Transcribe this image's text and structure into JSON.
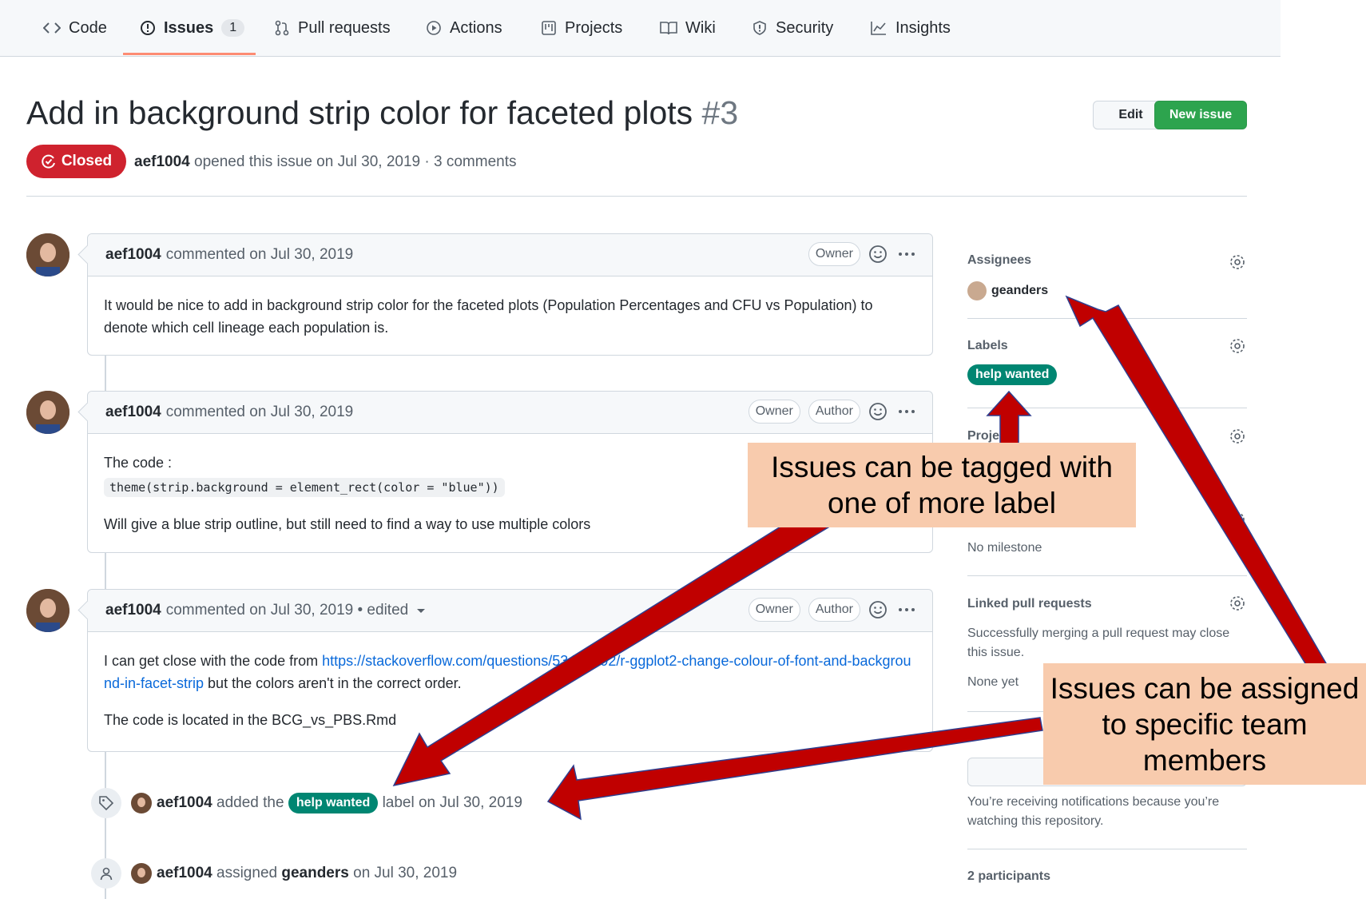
{
  "nav": {
    "tabs": [
      {
        "label": "Code"
      },
      {
        "label": "Issues",
        "count": "1"
      },
      {
        "label": "Pull requests"
      },
      {
        "label": "Actions"
      },
      {
        "label": "Projects"
      },
      {
        "label": "Wiki"
      },
      {
        "label": "Security"
      },
      {
        "label": "Insights"
      }
    ]
  },
  "issue": {
    "title": "Add in background strip color for faceted plots",
    "number": "#3",
    "state": "Closed",
    "author": "aef1004",
    "meta_text": "opened this issue on Jul 30, 2019 · 3 comments",
    "edit_label": "Edit",
    "new_issue_label": "New issue"
  },
  "comments": [
    {
      "author": "aef1004",
      "header_text": "commented on Jul 30, 2019",
      "roles": [
        "Owner"
      ],
      "body": "It would be nice to add in background strip color for the faceted plots (Population Percentages and CFU vs Population) to denote which cell lineage each population is."
    },
    {
      "author": "aef1004",
      "header_text": "commented on Jul 30, 2019",
      "roles": [
        "Owner",
        "Author"
      ],
      "line1": "The code :",
      "code": "theme(strip.background = element_rect(color = \"blue\"))",
      "line2": "Will give a blue strip outline, but still need to find a way to use multiple colors"
    },
    {
      "author": "aef1004",
      "header_text": "commented on Jul 30, 2019 • edited",
      "roles": [
        "Owner",
        "Author"
      ],
      "prefix": "I can get close with the code from ",
      "link": "https://stackoverflow.com/questions/53455092/r-ggplot2-change-colour-of-font-and-background-in-facet-strip",
      "suffix": " but the colors aren't in the correct order.",
      "line2": "The code is located in the BCG_vs_PBS.Rmd"
    }
  ],
  "events": [
    {
      "actor": "aef1004",
      "pre": "added the",
      "label": "help wanted",
      "post": "label on Jul 30, 2019"
    },
    {
      "actor": "aef1004",
      "pre": "assigned",
      "target": "geanders",
      "post": "on Jul 30, 2019"
    }
  ],
  "sidebar": {
    "assignees_heading": "Assignees",
    "assignee": "geanders",
    "labels_heading": "Labels",
    "label": "help wanted",
    "projects_heading": "Projects",
    "no_milestone": "No milestone",
    "linked_heading": "Linked pull requests",
    "linked_text": "Successfully merging a pull request may close this issue.",
    "none_yet": "None yet",
    "notify_text": "You’re receiving notifications because you’re watching this repository.",
    "participants": "2 participants"
  },
  "annotations": {
    "label_callout": "Issues can be tagged with one of more label",
    "assign_callout": "Issues can be assigned to specific team members"
  },
  "colors": {
    "closed": "#cf222e",
    "new_issue": "#2da44e",
    "label": "#008672",
    "callout": "#f8cbad",
    "arrow": "#c00000"
  }
}
